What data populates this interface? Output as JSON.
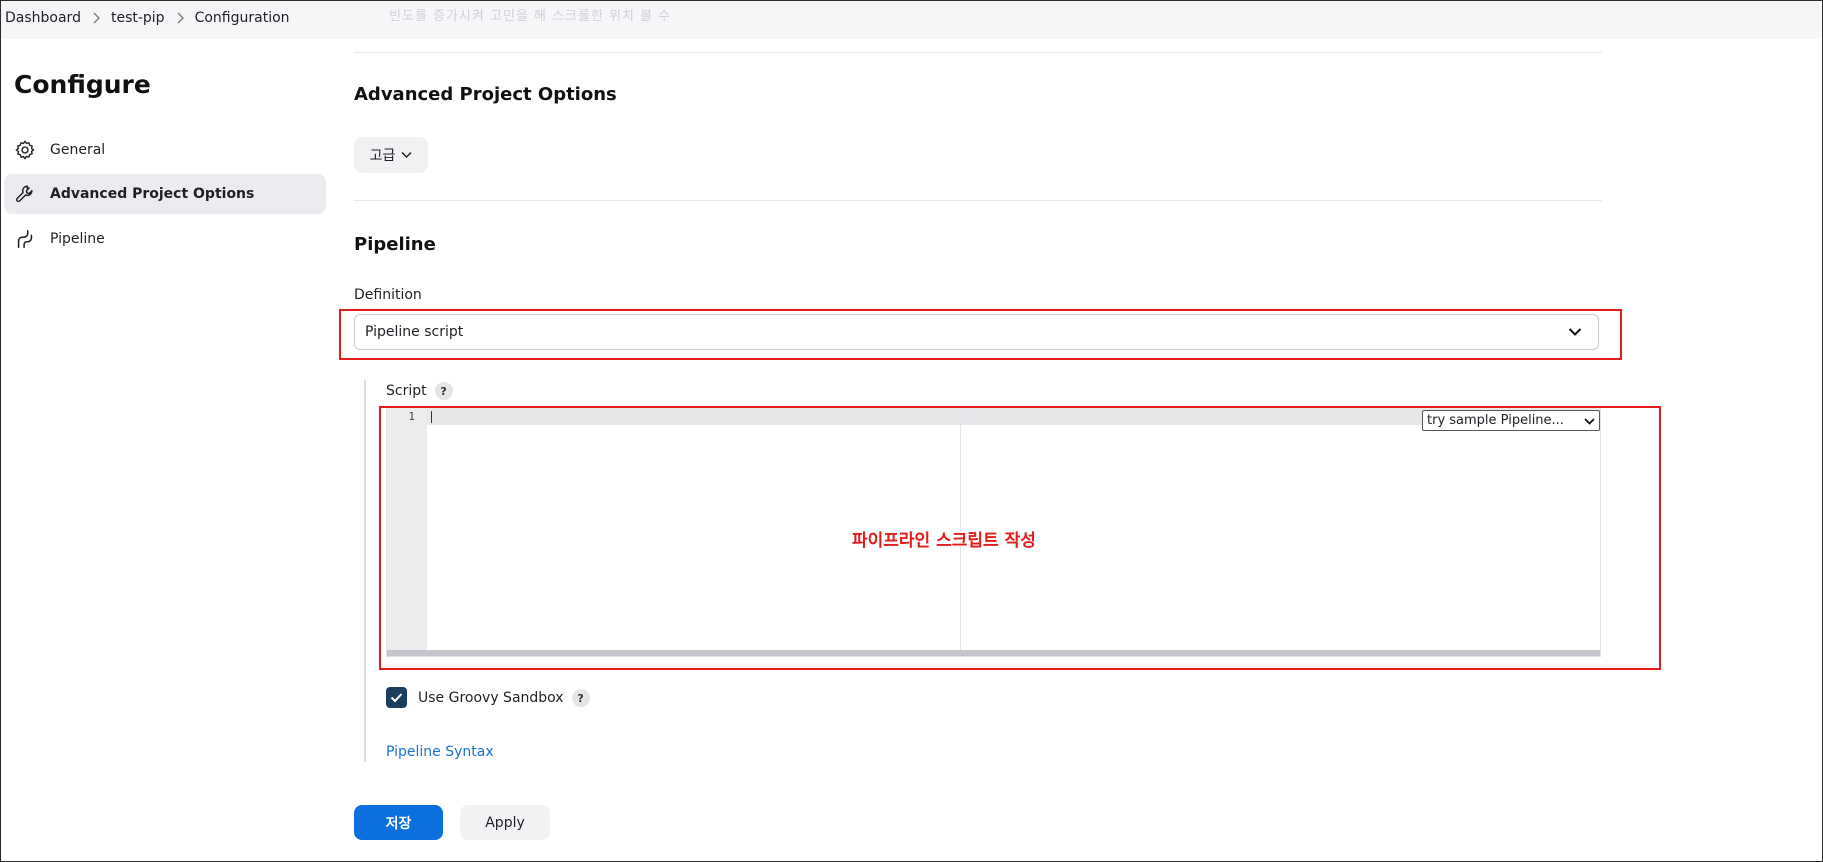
{
  "breadcrumb": {
    "items": [
      "Dashboard",
      "test-pip",
      "Configuration"
    ],
    "faded_text": "빈도를 증가시켜 고민을 해 스크롤한 위치 볼 수"
  },
  "sidebar": {
    "title": "Configure",
    "items": [
      {
        "label": "General",
        "icon": "gear-icon",
        "active": false
      },
      {
        "label": "Advanced Project Options",
        "icon": "wrench-icon",
        "active": true
      },
      {
        "label": "Pipeline",
        "icon": "pipeline-icon",
        "active": false
      }
    ]
  },
  "advanced": {
    "title": "Advanced Project Options",
    "button_label": "고급"
  },
  "pipeline": {
    "title": "Pipeline",
    "definition_label": "Definition",
    "definition_value": "Pipeline script",
    "script_label": "Script",
    "help_label": "?",
    "line_number": "1",
    "sample_select_value": "try sample Pipeline...",
    "annotation": "파이프라인 스크립트 작성",
    "sandbox_label": "Use Groovy Sandbox",
    "sandbox_checked": true,
    "syntax_link": "Pipeline Syntax"
  },
  "actions": {
    "save_label": "저장",
    "apply_label": "Apply"
  },
  "colors": {
    "accent": "#0b6fde",
    "annotation_red": "#e41b1b",
    "checkbox": "#1c3e5e",
    "link": "#1a70d8"
  }
}
